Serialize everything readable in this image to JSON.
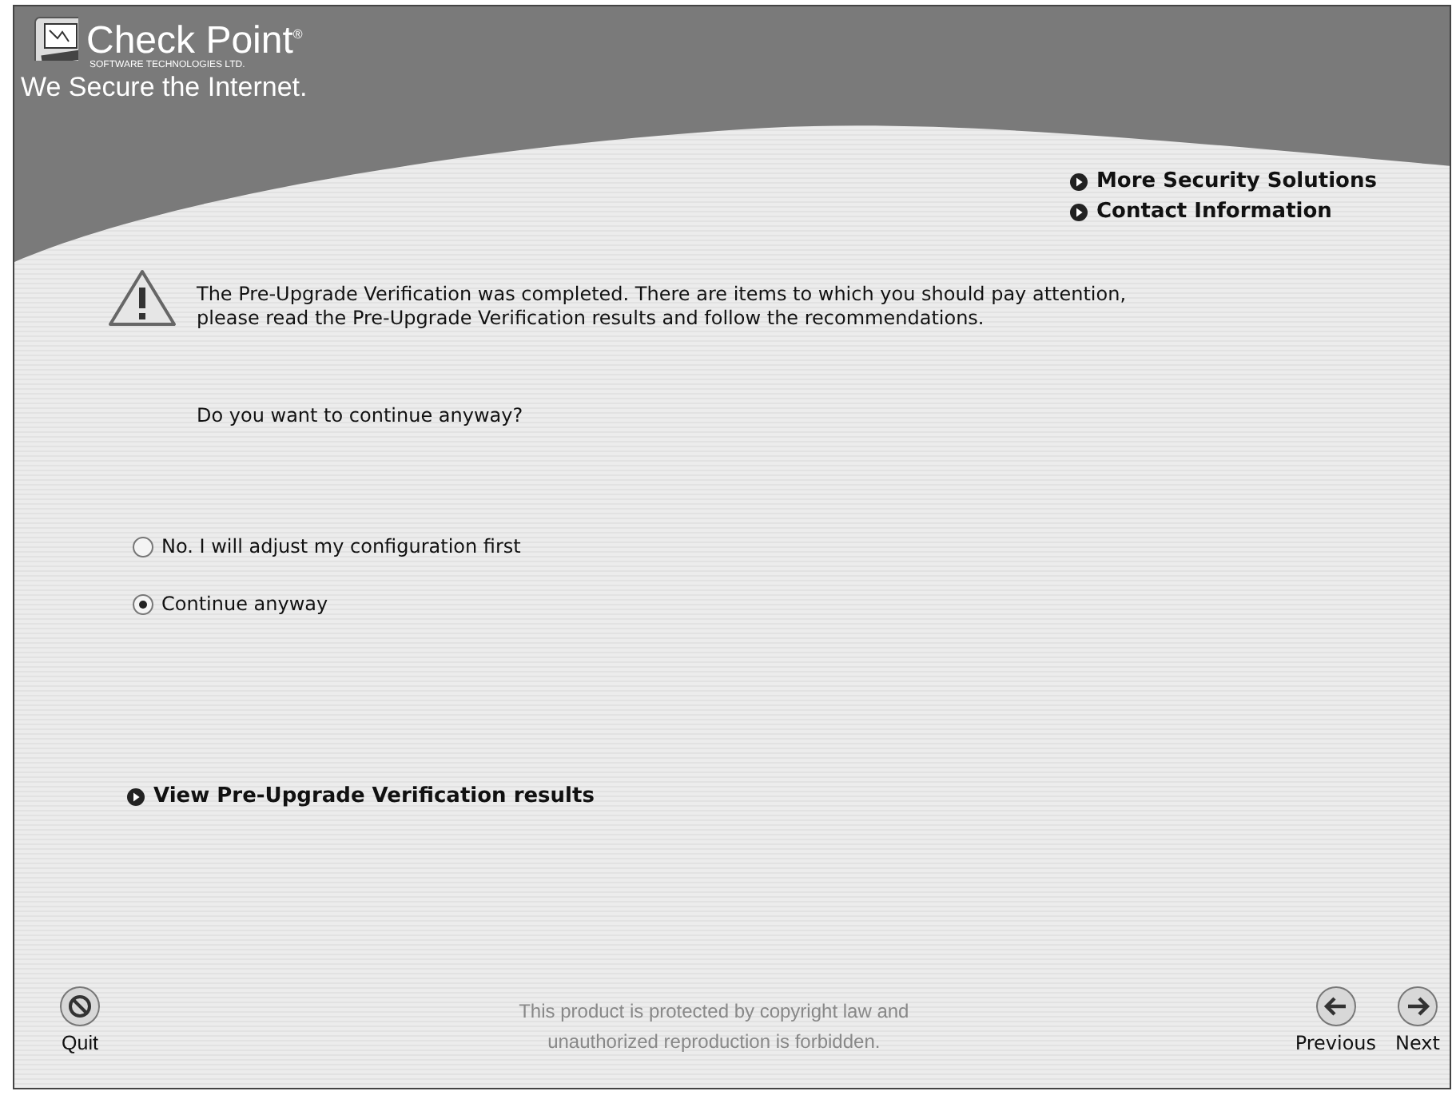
{
  "header": {
    "brand": "Check Point$^{®}$",
    "brand_sub": "SOFTWARE TECHNOLOGIES LTD.",
    "tagline": "We Secure the Internet.",
    "links": [
      "More Security Solutions",
      "Contact Information"
    ]
  },
  "message": "The Pre-Upgrade Verification was completed. There are items to which you should pay attention, please read the Pre-Upgrade Verification results and follow the recommendations.",
  "question": "Do you want to continue anyway?",
  "options": [
    {
      "label": "No. I will adjust my configuration first",
      "selected": false
    },
    {
      "label": "Continue anyway",
      "selected": true
    }
  ],
  "results_link": "View Pre-Upgrade Verification results",
  "footer": {
    "quit": "Quit",
    "notice": "This product is protected by copyright law and unauthorized reproduction is forbidden.",
    "previous": "Previous",
    "next": "Next"
  }
}
